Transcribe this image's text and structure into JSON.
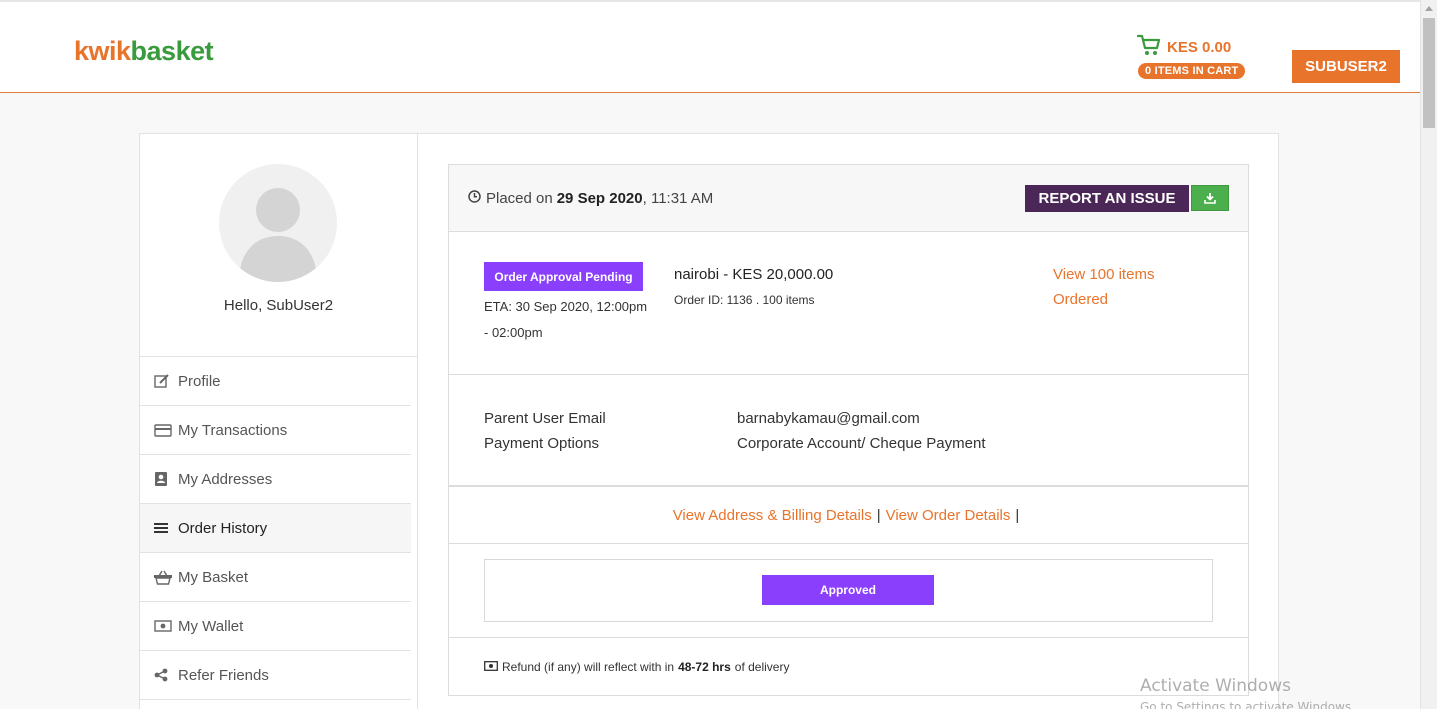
{
  "header": {
    "logo_part1": "kwik",
    "logo_part2": "basket",
    "cart_total": "KES 0.00",
    "cart_items": "0 ITEMS IN CART",
    "user_button": "SUBUSER2"
  },
  "sidebar": {
    "greeting": "Hello, SubUser2",
    "items": [
      {
        "label": "Profile",
        "icon": "edit-icon"
      },
      {
        "label": "My Transactions",
        "icon": "credit-card-icon"
      },
      {
        "label": "My Addresses",
        "icon": "address-book-icon"
      },
      {
        "label": "Order History",
        "icon": "list-icon",
        "active": true
      },
      {
        "label": "My Basket",
        "icon": "basket-icon"
      },
      {
        "label": "My Wallet",
        "icon": "money-icon"
      },
      {
        "label": "Refer Friends",
        "icon": "share-icon"
      }
    ]
  },
  "order": {
    "placed_prefix": "Placed on",
    "placed_date": "29 Sep 2020",
    "placed_time": ", 11:31 AM",
    "report_button": "REPORT AN ISSUE",
    "status": "Order Approval Pending",
    "eta": "ETA: 30 Sep 2020, 12:00pm - 02:00pm",
    "store_total": "nairobi - KES 20,000.00",
    "order_id": "Order ID: 1136 . 100 items",
    "view_items": "View 100 items Ordered",
    "parent_email_label": "Parent User Email",
    "parent_email_value": "barnabykamau@gmail.com",
    "payment_label": "Payment Options",
    "payment_value": "Corporate Account/ Cheque Payment",
    "address_link": "View Address & Billing Details",
    "details_link": "View Order Details",
    "separator": "|",
    "approved_button": "Approved",
    "refund_prefix": "Refund (if any) will reflect with in",
    "refund_hours": "48-72 hrs",
    "refund_suffix": "of delivery"
  },
  "watermark": {
    "line1": "Activate Windows",
    "line2": "Go to Settings to activate Windows."
  },
  "colors": {
    "accent": "#e8742c",
    "brand_green": "#3a9a3e",
    "purple": "#8a3ffc",
    "report_button": "#4b2757",
    "download_button": "#4cae4c"
  }
}
